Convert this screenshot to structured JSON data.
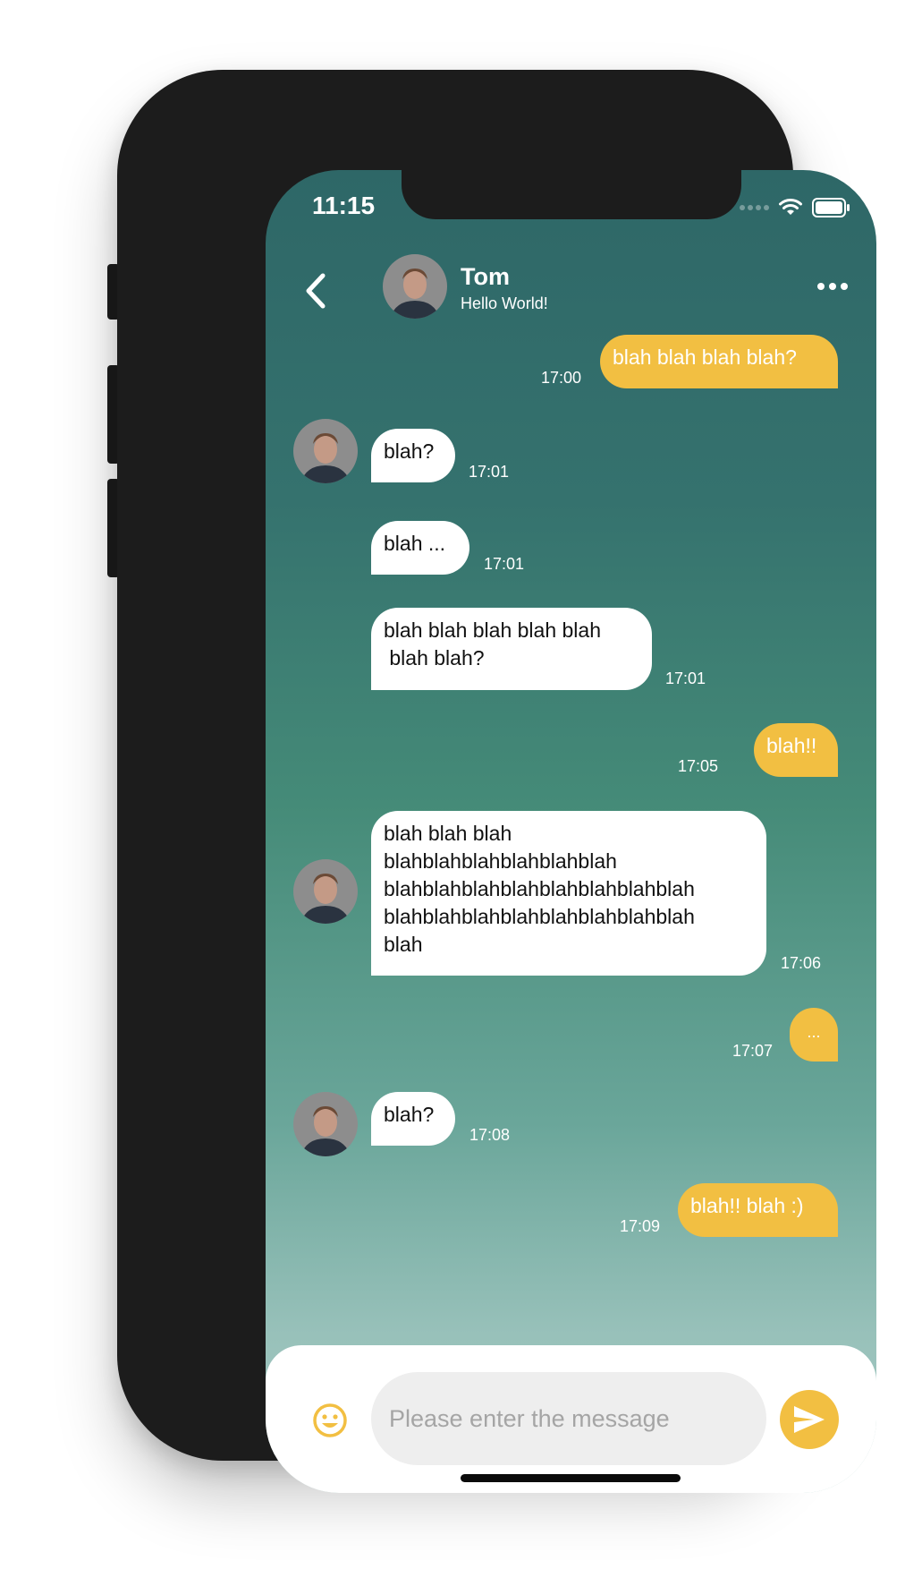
{
  "status_bar": {
    "time": "11:15"
  },
  "header": {
    "name": "Tom",
    "status": "Hello World!"
  },
  "messages": [
    {
      "from": "me",
      "text": "blah blah blah blah?",
      "time": "17:00"
    },
    {
      "from": "tom",
      "text": "blah?",
      "time": "17:01"
    },
    {
      "from": "tom",
      "text": "blah ...",
      "time": "17:01"
    },
    {
      "from": "tom",
      "text": "blah blah blah blah blah\n blah blah?",
      "time": "17:01"
    },
    {
      "from": "me",
      "text": "blah!!",
      "time": "17:05"
    },
    {
      "from": "tom",
      "text": "blah blah blah\nblahblahblahblahblahblah\nblahblahblahblahblahblahblahblah\nblahblahblahblahblahblahblahblah\nblah",
      "time": "17:06"
    },
    {
      "from": "me",
      "text": "...",
      "time": "17:07"
    },
    {
      "from": "tom",
      "text": "blah?",
      "time": "17:08"
    },
    {
      "from": "me",
      "text": "blah!! blah :)",
      "time": "17:09"
    }
  ],
  "composer": {
    "placeholder": "Please enter the message",
    "value": ""
  },
  "colors": {
    "accent": "#f2bf42",
    "gradient_top": "#2e6767",
    "gradient_bottom": "#a8cac4"
  },
  "icons": {
    "back": "chevron-left-icon",
    "more": "more-horizontal-icon",
    "emoji": "smiley-icon",
    "send": "send-icon"
  }
}
